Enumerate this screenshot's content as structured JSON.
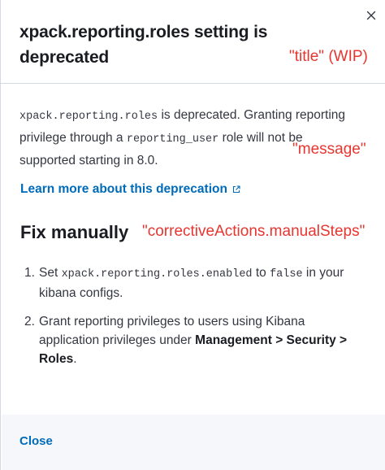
{
  "header": {
    "title": "xpack.reporting.roles setting is deprecated",
    "close_icon": "close-icon",
    "annotation": "\"title\" (WIP)"
  },
  "message": {
    "code1": "xpack.reporting.roles",
    "text1": " is deprecated. Granting reporting privilege through a ",
    "code2": "reporting_user",
    "text2": " role will not be supported starting in 8.0.",
    "annotation": "\"message\""
  },
  "learn_more": {
    "label": "Learn more about this deprecation",
    "icon": "popout-icon",
    "color": "#006bb8"
  },
  "corrective_actions": {
    "heading": "Fix manually",
    "annotation": "\"correctiveActions.manualSteps\"",
    "steps": [
      {
        "num": "1.",
        "pre": "Set ",
        "code1": "xpack.reporting.roles.enabled",
        "mid": " to ",
        "code2": "false",
        "post": " in your kibana configs."
      },
      {
        "num": "2.",
        "pre": "Grant reporting privileges to users using Kibana application privileges under ",
        "bold": "Management > Security > Roles",
        "post": "."
      }
    ]
  },
  "footer": {
    "close_label": "Close"
  },
  "colors": {
    "link": "#006bb8",
    "annotation": "#e7352f",
    "footer_bg": "#f5f7fa"
  }
}
